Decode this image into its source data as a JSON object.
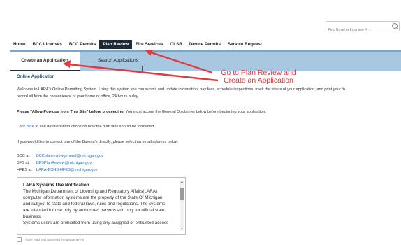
{
  "search": {
    "placeholder": "Find Email or Licensee # →"
  },
  "nav": {
    "items": [
      {
        "label": "Home"
      },
      {
        "label": "BCC Licenses"
      },
      {
        "label": "BCC Permits"
      },
      {
        "label": "Plan Review",
        "active": true
      },
      {
        "label": "Fire Services"
      },
      {
        "label": "OLSR"
      },
      {
        "label": "Device Permits"
      },
      {
        "label": "Service Request"
      }
    ]
  },
  "subnav": {
    "create": "Create an Application",
    "search": "Search Applications"
  },
  "content": {
    "title": "Online Application",
    "welcome_1": "Welcome to LARA's Online Permitting System. Using this system you can submit and update information, pay fees, schedule inspections, track the status of your application, and print your fo",
    "welcome_2": "record all from the convenience of your home or office, 24 hours a day.",
    "popups_bold": "Please \"Allow Pop-ups from This Site\" before proceeding.",
    "popups_rest": " You must accept the General Disclaimer below before beginning your application.",
    "click_pre": "Click ",
    "click_link": "here",
    "click_post": " to see detailed instructions on how the plan files should be formatted.",
    "contact": "If you would like to contact one of the Bureau's directly, please select an email address below.",
    "emails": [
      {
        "label": "BCC at:",
        "address": "BCCplanreviewgeneral@michigan.gov"
      },
      {
        "label": "BFS at:",
        "address": "BFSPlanReview@michigan.gov"
      },
      {
        "label": "HFES at:",
        "address": "LARA-BCHS-HFES@michigan.gov"
      }
    ]
  },
  "notice": {
    "title": "LARA Systems Use Notification",
    "lines": [
      "The Michigan Department of Licensing and Regulatory Affairs(LARA)",
      "computer information systems are the property of the State Of Michigan",
      "and subject to state and federal laws, rules and regulations. The systems",
      "are intended for use only by authorized persons and only for official state",
      "business.",
      "Systems users are prohibited from using any assigned or entrusted access"
    ]
  },
  "agree": {
    "label": "I have read and accepted the above terms"
  },
  "annotation": {
    "line1": "Go to Plan Review and",
    "line2": "Create an Application",
    "color": "#e03a3e"
  }
}
